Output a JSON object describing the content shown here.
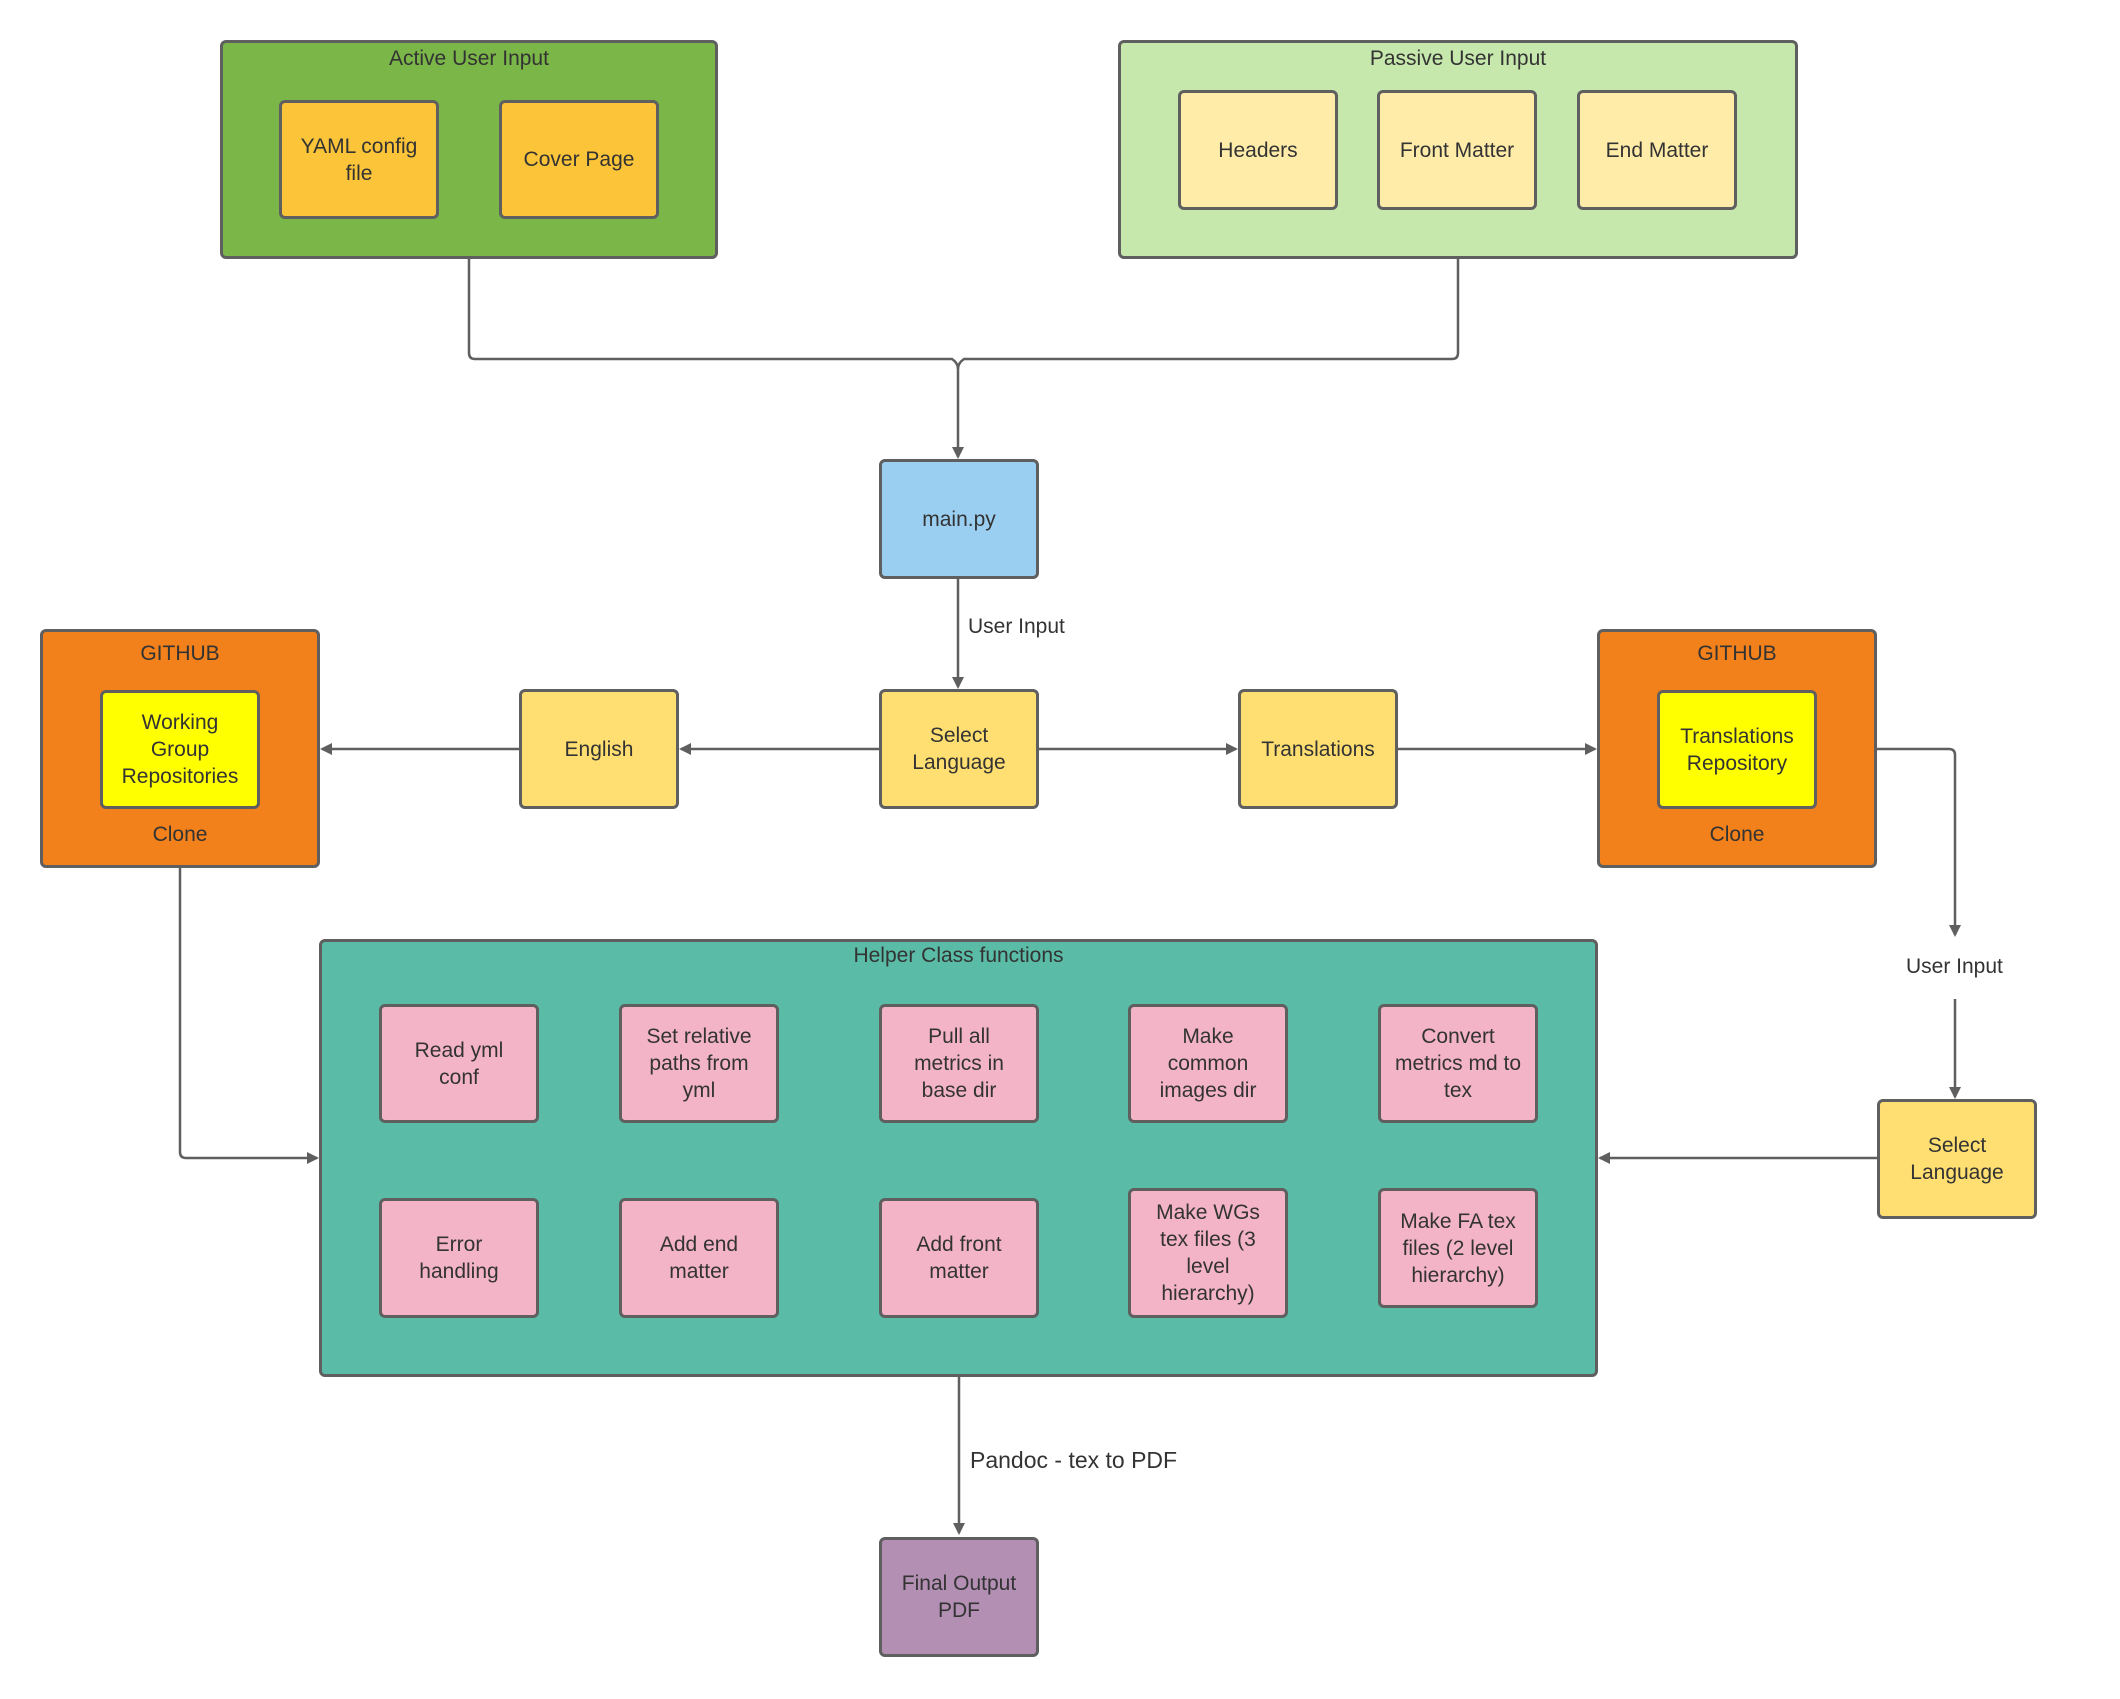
{
  "active_input": {
    "title": "Active User Input",
    "items": [
      "YAML config file",
      "Cover Page"
    ]
  },
  "passive_input": {
    "title": "Passive User Input",
    "items": [
      "Headers",
      "Front Matter",
      "End Matter"
    ]
  },
  "main": {
    "label": "main.py"
  },
  "edge_labels": {
    "main_to_select": "User Input",
    "right_user_input": "User Input",
    "pandoc": "Pandoc - tex to PDF"
  },
  "language_select": {
    "label": "Select Language"
  },
  "english": {
    "label": "English"
  },
  "translations": {
    "label": "Translations"
  },
  "github_left": {
    "title": "GITHUB",
    "inner": "Working Group Repositories",
    "footer": "Clone"
  },
  "github_right": {
    "title": "GITHUB",
    "inner": "Translations Repository",
    "footer": "Clone"
  },
  "right_language_select": {
    "label": "Select Language"
  },
  "helper": {
    "title": "Helper Class functions",
    "row1": [
      "Read yml conf",
      "Set relative paths from yml",
      "Pull all metrics in base dir",
      "Make common images dir",
      "Convert metrics md to tex"
    ],
    "row2": [
      "Error handling",
      "Add end matter",
      "Add front matter",
      "Make WGs tex files (3 level hierarchy)",
      "Make FA tex files (2 level hierarchy)"
    ]
  },
  "final_output": {
    "label": "Final Output PDF"
  },
  "colors": {
    "active_container": "#7ab648",
    "passive_container": "#c7e8ac",
    "active_item": "#fcc438",
    "passive_item": "#ffeca9",
    "main": "#9acff2",
    "language": "#ffdf71",
    "github": "#f2801b",
    "repo": "#ffff00",
    "helper": "#5abba7",
    "helper_item": "#f4b4c8",
    "final_output": "#b28fb3",
    "edge": "#5f5f5f"
  }
}
